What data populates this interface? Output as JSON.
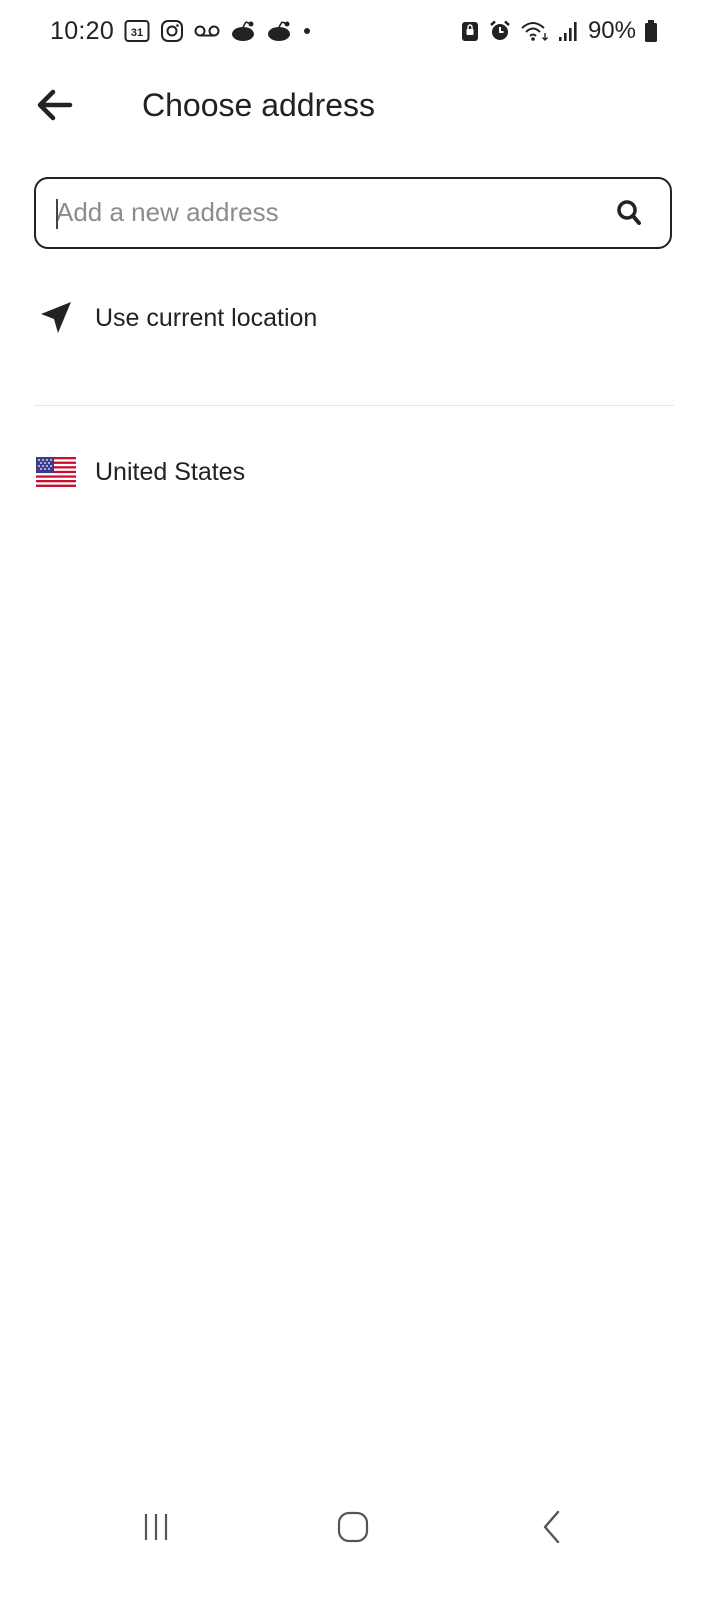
{
  "status_bar": {
    "time": "10:20",
    "calendar_day": "31",
    "battery": "90%",
    "left_icons": [
      "calendar-icon",
      "instagram-icon",
      "voicemail-icon",
      "reddit-icon",
      "reddit-icon",
      "dot-icon"
    ],
    "right_icons": [
      "lock-icon",
      "alarm-icon",
      "wifi-icon",
      "signal-icon",
      "battery-icon"
    ]
  },
  "header": {
    "title": "Choose address",
    "back_icon": "arrow-left-icon"
  },
  "search": {
    "placeholder": "Add a new address",
    "value": "",
    "icon": "search-icon"
  },
  "options": [
    {
      "label": "Use current location",
      "icon": "navigation-arrow-icon"
    },
    {
      "label": "United States",
      "icon": "us-flag-icon"
    }
  ],
  "nav_bar": {
    "buttons": [
      "recent-apps-icon",
      "home-icon",
      "back-icon"
    ]
  },
  "colors": {
    "text": "#222222",
    "placeholder": "#8c8c8c",
    "divider": "#e6e6e6",
    "background": "#ffffff"
  }
}
